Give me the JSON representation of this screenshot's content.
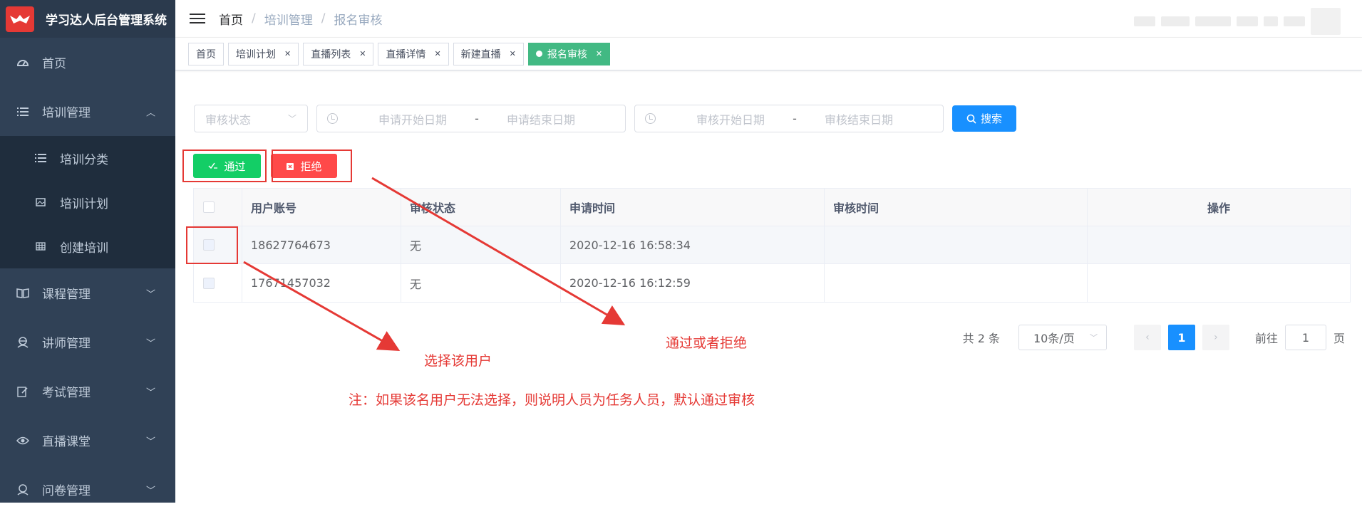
{
  "app": {
    "title": "学习达人后台管理系统"
  },
  "sidebar": {
    "items": [
      {
        "label": "首页",
        "icon": "dashboard-icon"
      },
      {
        "label": "培训管理",
        "icon": "list-icon",
        "expanded": true,
        "children": [
          {
            "label": "培训分类",
            "icon": "list-icon"
          },
          {
            "label": "培训计划",
            "icon": "image-icon"
          },
          {
            "label": "创建培训",
            "icon": "table-icon"
          }
        ]
      },
      {
        "label": "课程管理",
        "icon": "book-icon"
      },
      {
        "label": "讲师管理",
        "icon": "teacher-icon"
      },
      {
        "label": "考试管理",
        "icon": "edit-icon"
      },
      {
        "label": "直播课堂",
        "icon": "eye-icon"
      },
      {
        "label": "问卷管理",
        "icon": "survey-icon"
      }
    ]
  },
  "breadcrumb": {
    "home": "首页",
    "sep": "/",
    "level1": "培训管理",
    "level2": "报名审核"
  },
  "tags": [
    {
      "label": "首页",
      "closable": false,
      "active": false
    },
    {
      "label": "培训计划",
      "closable": true,
      "active": false
    },
    {
      "label": "直播列表",
      "closable": true,
      "active": false
    },
    {
      "label": "直播详情",
      "closable": true,
      "active": false
    },
    {
      "label": "新建直播",
      "closable": true,
      "active": false
    },
    {
      "label": "报名审核",
      "closable": true,
      "active": true
    }
  ],
  "filters": {
    "status_placeholder": "审核状态",
    "apply_start": "申请开始日期",
    "apply_end": "申请结束日期",
    "review_start": "审核开始日期",
    "review_end": "审核结束日期",
    "range_sep": "-",
    "search_label": "搜索"
  },
  "actions": {
    "pass_label": "通过",
    "reject_label": "拒绝"
  },
  "table": {
    "headers": [
      "用户账号",
      "审核状态",
      "申请时间",
      "审核时间",
      "操作"
    ],
    "rows": [
      {
        "account": "18627764673",
        "status": "无",
        "apply_time": "2020-12-16 16:58:34",
        "review_time": "",
        "op": ""
      },
      {
        "account": "17671457032",
        "status": "无",
        "apply_time": "2020-12-16 16:12:59",
        "review_time": "",
        "op": ""
      }
    ]
  },
  "pagination": {
    "total": "共 2 条",
    "page_size": "10条/页",
    "current_page": "1",
    "goto_label": "前往",
    "goto_value": "1",
    "page_unit": "页"
  },
  "annotations": {
    "select_user": "选择该用户",
    "pass_or_reject": "通过或者拒绝",
    "note": "注：如果该名用户无法选择，则说明人员为任务人员，默认通过审核"
  },
  "colors": {
    "sidebar_bg": "#304156",
    "active_tag": "#42b983",
    "primary": "#1890ff",
    "pass": "#13ce66",
    "reject": "#ff4949",
    "annotation": "#e53935"
  }
}
